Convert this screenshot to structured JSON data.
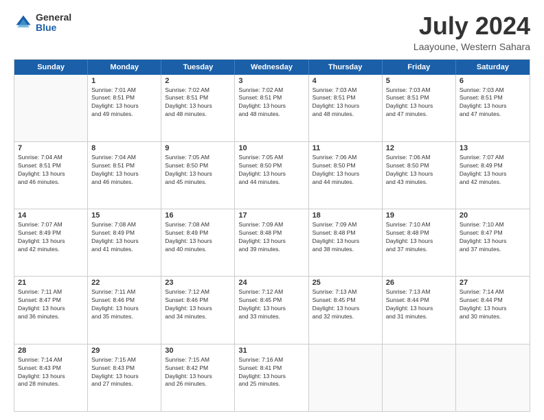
{
  "logo": {
    "general": "General",
    "blue": "Blue"
  },
  "title": "July 2024",
  "location": "Laayoune, Western Sahara",
  "days_of_week": [
    "Sunday",
    "Monday",
    "Tuesday",
    "Wednesday",
    "Thursday",
    "Friday",
    "Saturday"
  ],
  "weeks": [
    [
      {
        "day": "",
        "sunrise": "",
        "sunset": "",
        "daylight": "",
        "empty": true
      },
      {
        "day": "1",
        "sunrise": "Sunrise: 7:01 AM",
        "sunset": "Sunset: 8:51 PM",
        "daylight": "Daylight: 13 hours and 49 minutes.",
        "empty": false
      },
      {
        "day": "2",
        "sunrise": "Sunrise: 7:02 AM",
        "sunset": "Sunset: 8:51 PM",
        "daylight": "Daylight: 13 hours and 48 minutes.",
        "empty": false
      },
      {
        "day": "3",
        "sunrise": "Sunrise: 7:02 AM",
        "sunset": "Sunset: 8:51 PM",
        "daylight": "Daylight: 13 hours and 48 minutes.",
        "empty": false
      },
      {
        "day": "4",
        "sunrise": "Sunrise: 7:03 AM",
        "sunset": "Sunset: 8:51 PM",
        "daylight": "Daylight: 13 hours and 48 minutes.",
        "empty": false
      },
      {
        "day": "5",
        "sunrise": "Sunrise: 7:03 AM",
        "sunset": "Sunset: 8:51 PM",
        "daylight": "Daylight: 13 hours and 47 minutes.",
        "empty": false
      },
      {
        "day": "6",
        "sunrise": "Sunrise: 7:03 AM",
        "sunset": "Sunset: 8:51 PM",
        "daylight": "Daylight: 13 hours and 47 minutes.",
        "empty": false
      }
    ],
    [
      {
        "day": "7",
        "sunrise": "Sunrise: 7:04 AM",
        "sunset": "Sunset: 8:51 PM",
        "daylight": "Daylight: 13 hours and 46 minutes.",
        "empty": false
      },
      {
        "day": "8",
        "sunrise": "Sunrise: 7:04 AM",
        "sunset": "Sunset: 8:51 PM",
        "daylight": "Daylight: 13 hours and 46 minutes.",
        "empty": false
      },
      {
        "day": "9",
        "sunrise": "Sunrise: 7:05 AM",
        "sunset": "Sunset: 8:50 PM",
        "daylight": "Daylight: 13 hours and 45 minutes.",
        "empty": false
      },
      {
        "day": "10",
        "sunrise": "Sunrise: 7:05 AM",
        "sunset": "Sunset: 8:50 PM",
        "daylight": "Daylight: 13 hours and 44 minutes.",
        "empty": false
      },
      {
        "day": "11",
        "sunrise": "Sunrise: 7:06 AM",
        "sunset": "Sunset: 8:50 PM",
        "daylight": "Daylight: 13 hours and 44 minutes.",
        "empty": false
      },
      {
        "day": "12",
        "sunrise": "Sunrise: 7:06 AM",
        "sunset": "Sunset: 8:50 PM",
        "daylight": "Daylight: 13 hours and 43 minutes.",
        "empty": false
      },
      {
        "day": "13",
        "sunrise": "Sunrise: 7:07 AM",
        "sunset": "Sunset: 8:49 PM",
        "daylight": "Daylight: 13 hours and 42 minutes.",
        "empty": false
      }
    ],
    [
      {
        "day": "14",
        "sunrise": "Sunrise: 7:07 AM",
        "sunset": "Sunset: 8:49 PM",
        "daylight": "Daylight: 13 hours and 42 minutes.",
        "empty": false
      },
      {
        "day": "15",
        "sunrise": "Sunrise: 7:08 AM",
        "sunset": "Sunset: 8:49 PM",
        "daylight": "Daylight: 13 hours and 41 minutes.",
        "empty": false
      },
      {
        "day": "16",
        "sunrise": "Sunrise: 7:08 AM",
        "sunset": "Sunset: 8:49 PM",
        "daylight": "Daylight: 13 hours and 40 minutes.",
        "empty": false
      },
      {
        "day": "17",
        "sunrise": "Sunrise: 7:09 AM",
        "sunset": "Sunset: 8:48 PM",
        "daylight": "Daylight: 13 hours and 39 minutes.",
        "empty": false
      },
      {
        "day": "18",
        "sunrise": "Sunrise: 7:09 AM",
        "sunset": "Sunset: 8:48 PM",
        "daylight": "Daylight: 13 hours and 38 minutes.",
        "empty": false
      },
      {
        "day": "19",
        "sunrise": "Sunrise: 7:10 AM",
        "sunset": "Sunset: 8:48 PM",
        "daylight": "Daylight: 13 hours and 37 minutes.",
        "empty": false
      },
      {
        "day": "20",
        "sunrise": "Sunrise: 7:10 AM",
        "sunset": "Sunset: 8:47 PM",
        "daylight": "Daylight: 13 hours and 37 minutes.",
        "empty": false
      }
    ],
    [
      {
        "day": "21",
        "sunrise": "Sunrise: 7:11 AM",
        "sunset": "Sunset: 8:47 PM",
        "daylight": "Daylight: 13 hours and 36 minutes.",
        "empty": false
      },
      {
        "day": "22",
        "sunrise": "Sunrise: 7:11 AM",
        "sunset": "Sunset: 8:46 PM",
        "daylight": "Daylight: 13 hours and 35 minutes.",
        "empty": false
      },
      {
        "day": "23",
        "sunrise": "Sunrise: 7:12 AM",
        "sunset": "Sunset: 8:46 PM",
        "daylight": "Daylight: 13 hours and 34 minutes.",
        "empty": false
      },
      {
        "day": "24",
        "sunrise": "Sunrise: 7:12 AM",
        "sunset": "Sunset: 8:45 PM",
        "daylight": "Daylight: 13 hours and 33 minutes.",
        "empty": false
      },
      {
        "day": "25",
        "sunrise": "Sunrise: 7:13 AM",
        "sunset": "Sunset: 8:45 PM",
        "daylight": "Daylight: 13 hours and 32 minutes.",
        "empty": false
      },
      {
        "day": "26",
        "sunrise": "Sunrise: 7:13 AM",
        "sunset": "Sunset: 8:44 PM",
        "daylight": "Daylight: 13 hours and 31 minutes.",
        "empty": false
      },
      {
        "day": "27",
        "sunrise": "Sunrise: 7:14 AM",
        "sunset": "Sunset: 8:44 PM",
        "daylight": "Daylight: 13 hours and 30 minutes.",
        "empty": false
      }
    ],
    [
      {
        "day": "28",
        "sunrise": "Sunrise: 7:14 AM",
        "sunset": "Sunset: 8:43 PM",
        "daylight": "Daylight: 13 hours and 28 minutes.",
        "empty": false
      },
      {
        "day": "29",
        "sunrise": "Sunrise: 7:15 AM",
        "sunset": "Sunset: 8:43 PM",
        "daylight": "Daylight: 13 hours and 27 minutes.",
        "empty": false
      },
      {
        "day": "30",
        "sunrise": "Sunrise: 7:15 AM",
        "sunset": "Sunset: 8:42 PM",
        "daylight": "Daylight: 13 hours and 26 minutes.",
        "empty": false
      },
      {
        "day": "31",
        "sunrise": "Sunrise: 7:16 AM",
        "sunset": "Sunset: 8:41 PM",
        "daylight": "Daylight: 13 hours and 25 minutes.",
        "empty": false
      },
      {
        "day": "",
        "sunrise": "",
        "sunset": "",
        "daylight": "",
        "empty": true
      },
      {
        "day": "",
        "sunrise": "",
        "sunset": "",
        "daylight": "",
        "empty": true
      },
      {
        "day": "",
        "sunrise": "",
        "sunset": "",
        "daylight": "",
        "empty": true
      }
    ]
  ]
}
